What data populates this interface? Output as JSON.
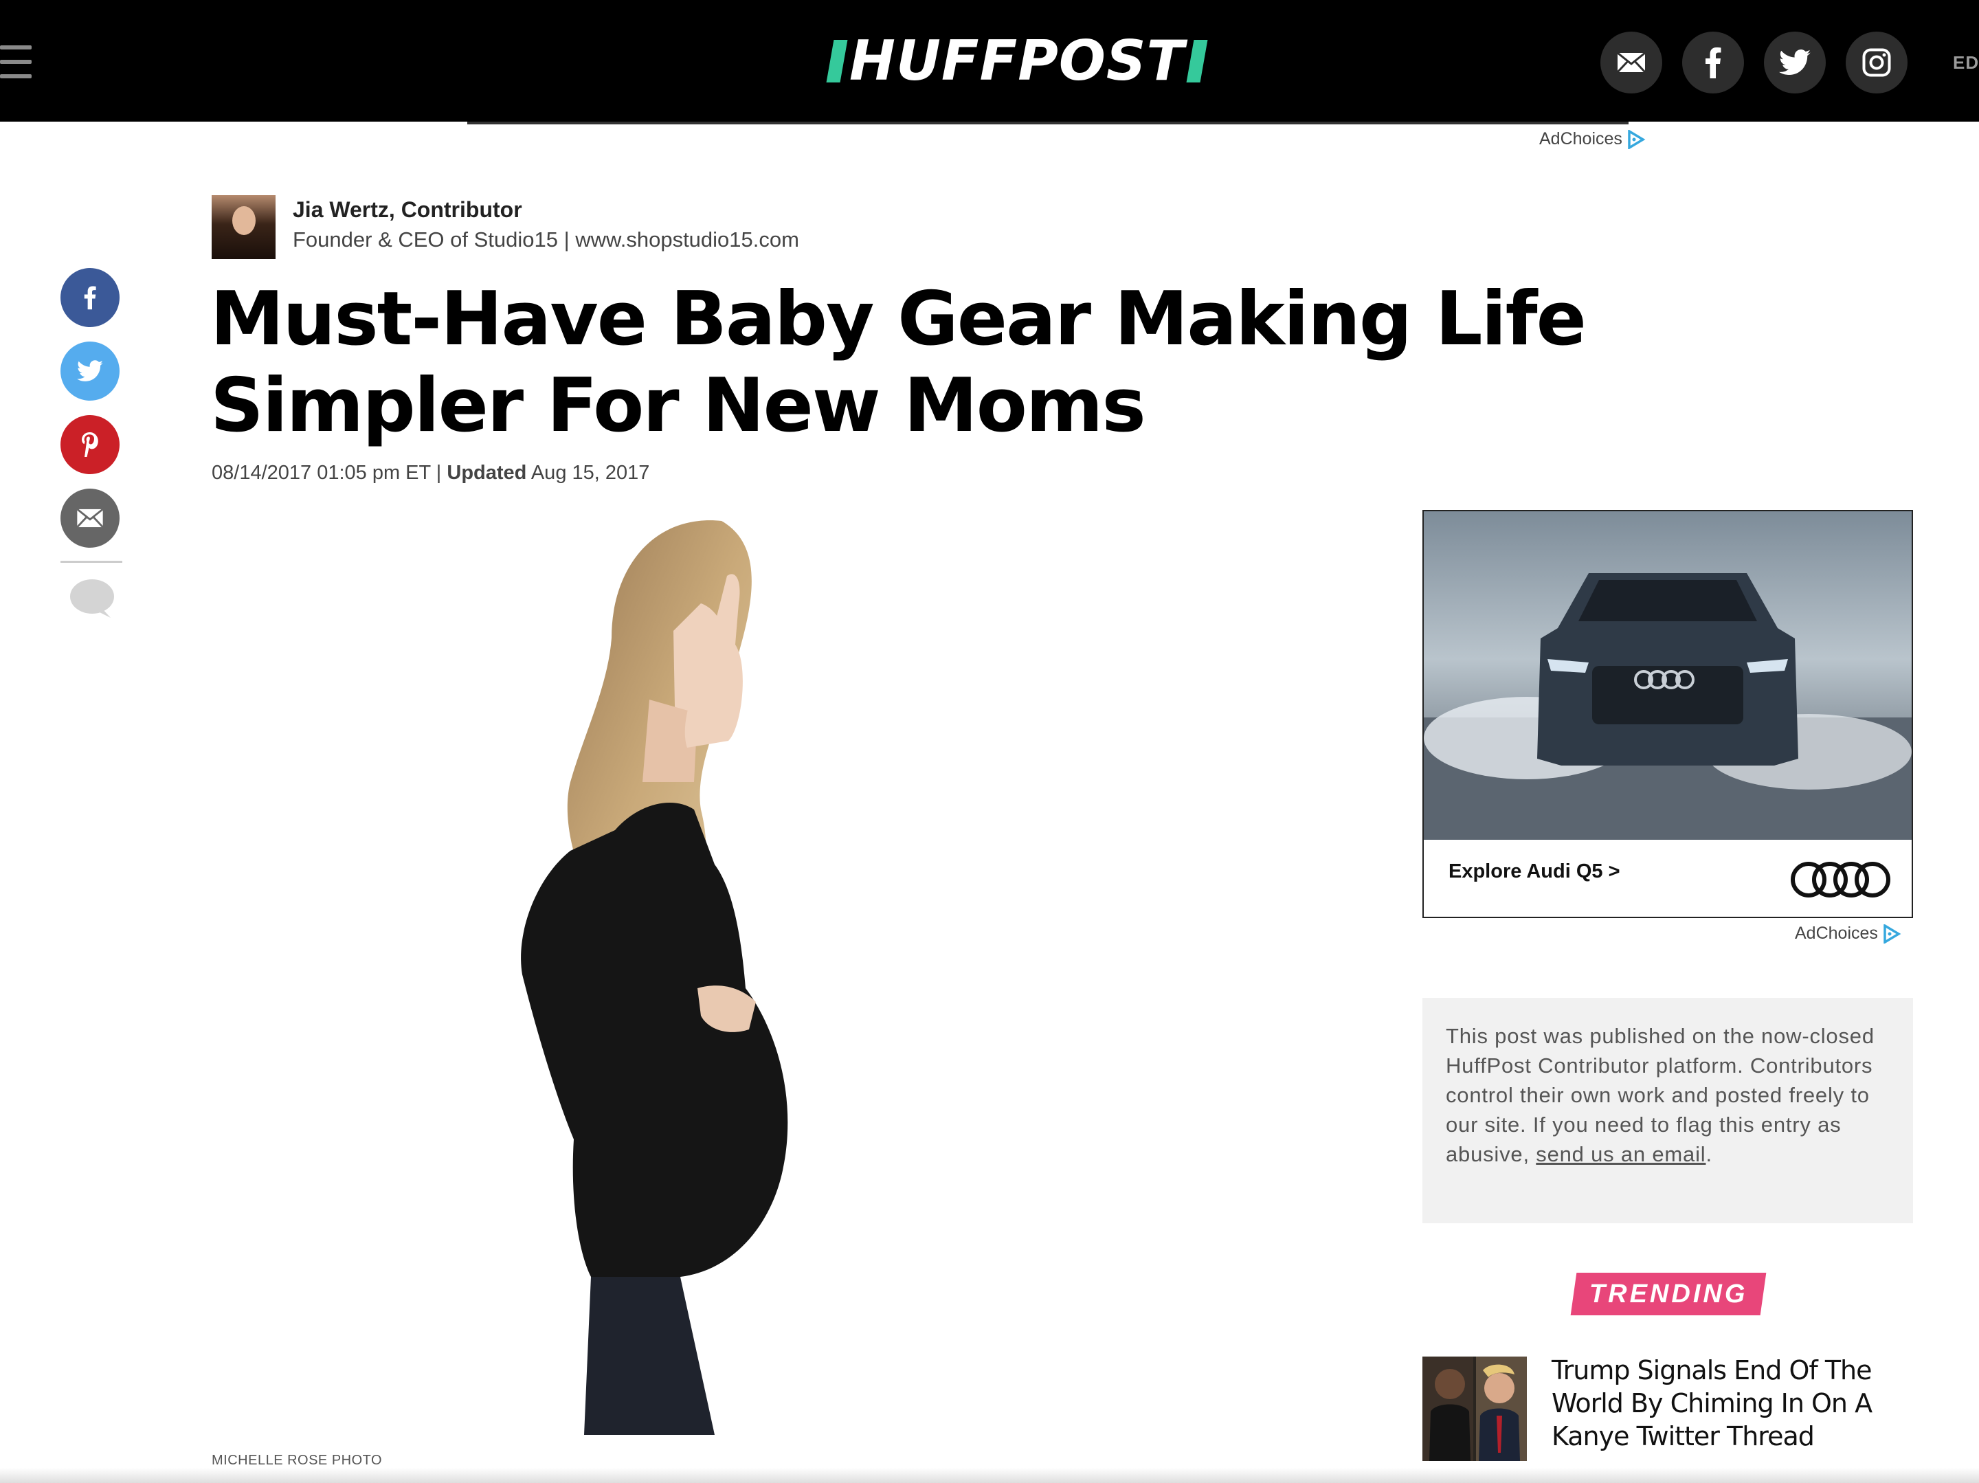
{
  "header": {
    "logo_text": "HUFFPOST",
    "edition_text": "EDI",
    "social_icons": [
      "email-icon",
      "facebook-icon",
      "twitter-icon",
      "instagram-icon"
    ]
  },
  "ads": {
    "adchoices_label": "AdChoices",
    "audi": {
      "cta": "Explore Audi Q5 >"
    }
  },
  "author": {
    "name": "Jia Wertz, Contributor",
    "bio": "Founder & CEO of Studio15 | www.shopstudio15.com"
  },
  "share_rail": [
    "facebook-icon",
    "twitter-icon",
    "pinterest-icon",
    "email-icon",
    "comment-icon"
  ],
  "article": {
    "headline": "Must-Have Baby Gear Making Life Simpler For New Moms",
    "date": "08/14/2017 01:05 pm ET",
    "separator": "|",
    "updated_label": "Updated",
    "updated_date": "Aug 15, 2017",
    "photo_credit": "MICHELLE ROSE PHOTO"
  },
  "notice": {
    "text": "This post was published on the now-closed HuffPost Contributor platform. Contributors control their own work and posted freely to our site. If you need to flag this entry as abusive,",
    "link_text": "send us an email",
    "end": "."
  },
  "trending": {
    "label": "TRENDING",
    "items": [
      {
        "title": "Trump Signals End Of The World By Chiming In On A Kanye Twitter Thread"
      }
    ]
  },
  "colors": {
    "header_bg": "#000000",
    "logo_accent": "#35c99b",
    "trending_pink": "#e8467a",
    "facebook": "#3b5998",
    "twitter": "#55acee",
    "pinterest": "#cb2027",
    "email_grey": "#666666"
  }
}
